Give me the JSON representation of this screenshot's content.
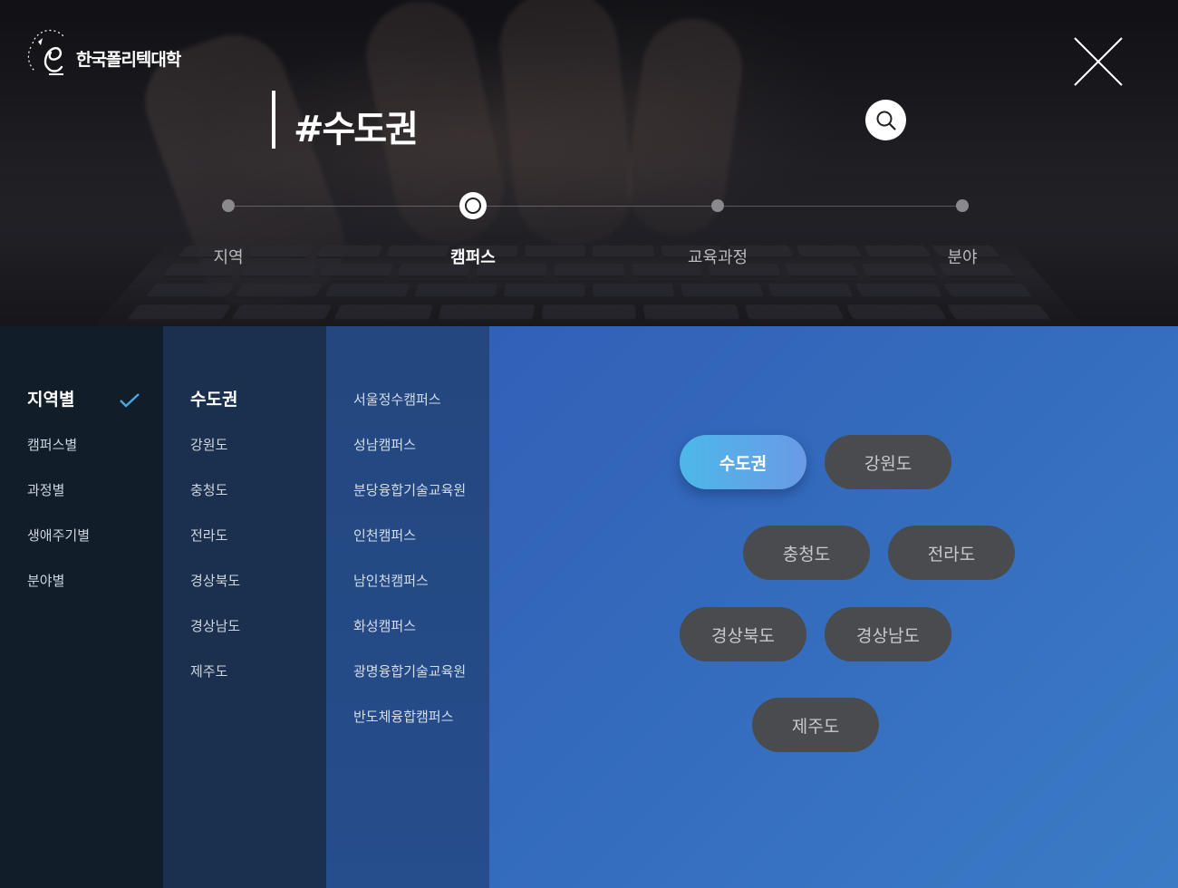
{
  "header": {
    "logo_text": "한국폴리텍대학",
    "search_query": "#수도권"
  },
  "steps": [
    {
      "label": "지역",
      "active": false
    },
    {
      "label": "캠퍼스",
      "active": true
    },
    {
      "label": "교육과정",
      "active": false
    },
    {
      "label": "분야",
      "active": false
    }
  ],
  "category_menu": [
    "지역별",
    "캠퍼스별",
    "과정별",
    "생애주기별",
    "분야별"
  ],
  "region_menu": [
    "수도권",
    "강원도",
    "충청도",
    "전라도",
    "경상북도",
    "경상남도",
    "제주도"
  ],
  "campus_menu": [
    "서울정수캠퍼스",
    "성남캠퍼스",
    "분당융합기술교육원",
    "인천캠퍼스",
    "남인천캠퍼스",
    "화성캠퍼스",
    "광명융합기술교육원",
    "반도체융합캠퍼스"
  ],
  "region_pills": [
    "수도권",
    "강원도",
    "충청도",
    "전라도",
    "경상북도",
    "경상남도",
    "제주도"
  ],
  "colors": {
    "active_pill_start": "#4db8e8",
    "active_pill_end": "#6a9ae6",
    "inactive_pill": "#4a4b4f",
    "check_color": "#4aa8e0"
  }
}
